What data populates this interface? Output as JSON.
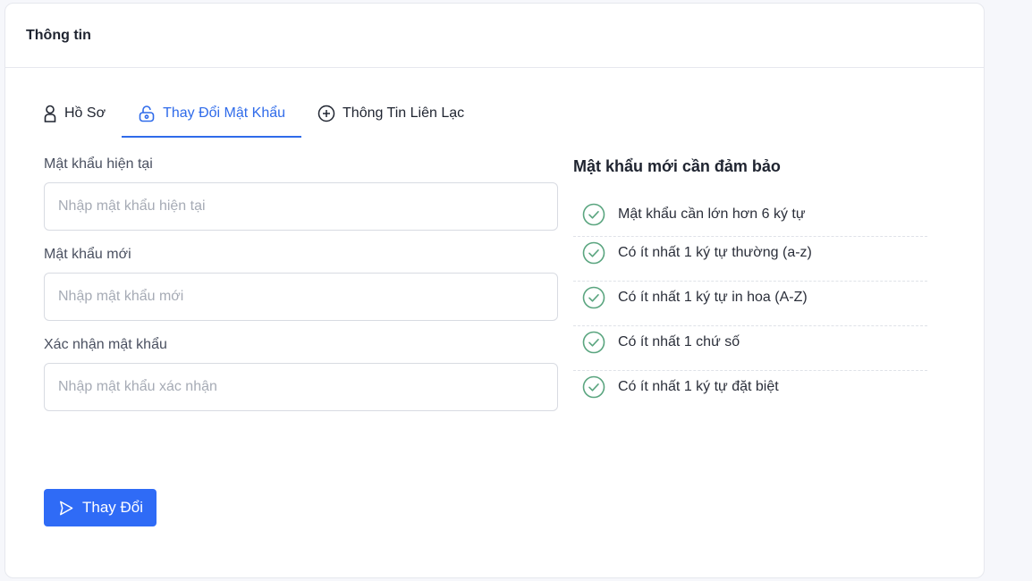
{
  "card": {
    "title": "Thông tin"
  },
  "tabs": [
    {
      "label": "Hồ Sơ",
      "icon": "user-icon"
    },
    {
      "label": "Thay Đổi Mật Khẩu",
      "icon": "lock-icon",
      "active": true
    },
    {
      "label": "Thông Tin Liên Lạc",
      "icon": "plus-circle-icon"
    }
  ],
  "form": {
    "current": {
      "label": "Mật khẩu hiện tại",
      "placeholder": "Nhập mật khẩu hiện tại",
      "value": ""
    },
    "new": {
      "label": "Mật khẩu mới",
      "placeholder": "Nhập mật khẩu mới",
      "value": ""
    },
    "confirm": {
      "label": "Xác nhận mật khẩu",
      "placeholder": "Nhập mật khẩu xác nhận",
      "value": ""
    },
    "submit_label": "Thay Đổi"
  },
  "rules": {
    "title": "Mật khẩu mới cần đảm bảo",
    "items": [
      "Mật khẩu cần lớn hơn 6 ký tự",
      "Có ít nhất 1 ký tự thường (a-z)",
      "Có ít nhất 1 ký tự in hoa (A-Z)",
      "Có ít nhất 1 chứ số",
      "Có ít nhất 1 ký tự đặt biệt"
    ]
  },
  "colors": {
    "accent": "#2f6bea",
    "check": "#5aa57f",
    "background": "#f6f7fb"
  }
}
